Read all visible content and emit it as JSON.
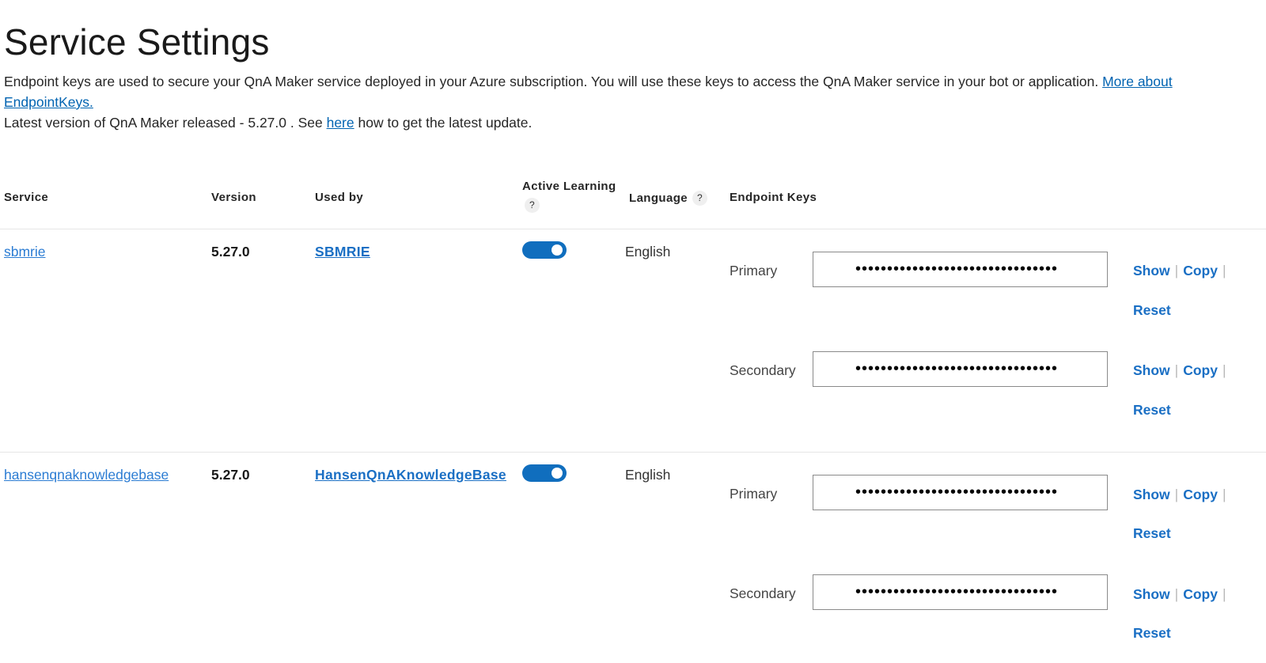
{
  "page": {
    "title": "Service Settings",
    "description": "Endpoint keys are used to secure your QnA Maker service deployed in your Azure subscription. You will use these keys to access the QnA Maker service in your bot or application. ",
    "description_link": "More about EndpointKeys.",
    "version_note_prefix": "Latest version of QnA Maker released - 5.27.0 . See ",
    "version_note_link": "here",
    "version_note_suffix": " how to get the latest update."
  },
  "table": {
    "headers": {
      "service": "Service",
      "version": "Version",
      "used_by": "Used by",
      "active_learning": "Active Learning",
      "language": "Language",
      "endpoint_keys": "Endpoint Keys",
      "help": "?"
    },
    "rows": [
      {
        "service": "sbmrie",
        "version": "5.27.0",
        "used_by": "SBMRIE",
        "active_learning": true,
        "language": "English",
        "primary_label": "Primary",
        "primary_value": "••••••••••••••••••••••••••••••••",
        "secondary_label": "Secondary",
        "secondary_value": "••••••••••••••••••••••••••••••••"
      },
      {
        "service": "hansenqnaknowledgebase",
        "version": "5.27.0",
        "used_by": "HansenQnAKnowledgeBase",
        "active_learning": true,
        "language": "English",
        "primary_label": "Primary",
        "primary_value": "••••••••••••••••••••••••••••••••",
        "secondary_label": "Secondary",
        "secondary_value": "••••••••••••••••••••••••••••••••"
      }
    ],
    "actions": {
      "show": "Show",
      "copy": "Copy",
      "reset": "Reset",
      "separator": "|"
    }
  },
  "colors": {
    "link": "#1a6fc4",
    "toggle_on": "#106ebe",
    "divider": "#e6e6e6"
  }
}
